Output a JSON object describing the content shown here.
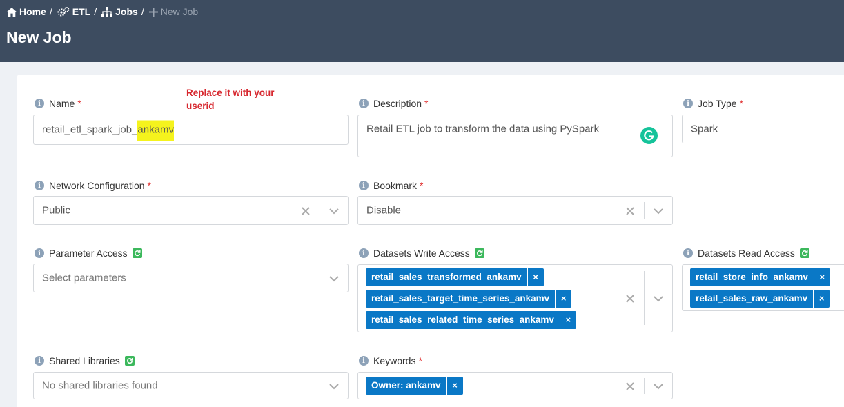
{
  "breadcrumb": {
    "home": "Home",
    "etl": "ETL",
    "jobs": "Jobs",
    "current": "New Job",
    "separator": "/"
  },
  "page": {
    "title": "New Job"
  },
  "annotation": {
    "text": "Replace it with your userid",
    "color": "#d7282f"
  },
  "form": {
    "required_mark": "*",
    "name": {
      "label": "Name",
      "value_prefix": "retail_etl_spark_job_",
      "value_highlight": "ankamv"
    },
    "description": {
      "label": "Description",
      "value": "Retail ETL job to transform the data using PySpark"
    },
    "job_type": {
      "label": "Job Type",
      "value": "Spark"
    },
    "network_configuration": {
      "label": "Network Configuration",
      "value": "Public"
    },
    "bookmark": {
      "label": "Bookmark",
      "value": "Disable"
    },
    "parameter_access": {
      "label": "Parameter Access",
      "placeholder": "Select parameters"
    },
    "datasets_write_access": {
      "label": "Datasets Write Access",
      "tags": [
        "retail_sales_transformed_ankamv",
        "retail_sales_target_time_series_ankamv",
        "retail_sales_related_time_series_ankamv"
      ]
    },
    "datasets_read_access": {
      "label": "Datasets Read Access",
      "tags": [
        "retail_store_info_ankamv",
        "retail_sales_raw_ankamv"
      ]
    },
    "shared_libraries": {
      "label": "Shared Libraries",
      "placeholder": "No shared libraries found"
    },
    "keywords": {
      "label": "Keywords",
      "tags": [
        "Owner: ankamv"
      ]
    },
    "tag_remove": "×"
  },
  "colors": {
    "header": "#3d4c60",
    "tag": "#0a78c6",
    "refresh": "#3cb85c",
    "highlight": "#f5f31d",
    "required": "#e03030"
  }
}
